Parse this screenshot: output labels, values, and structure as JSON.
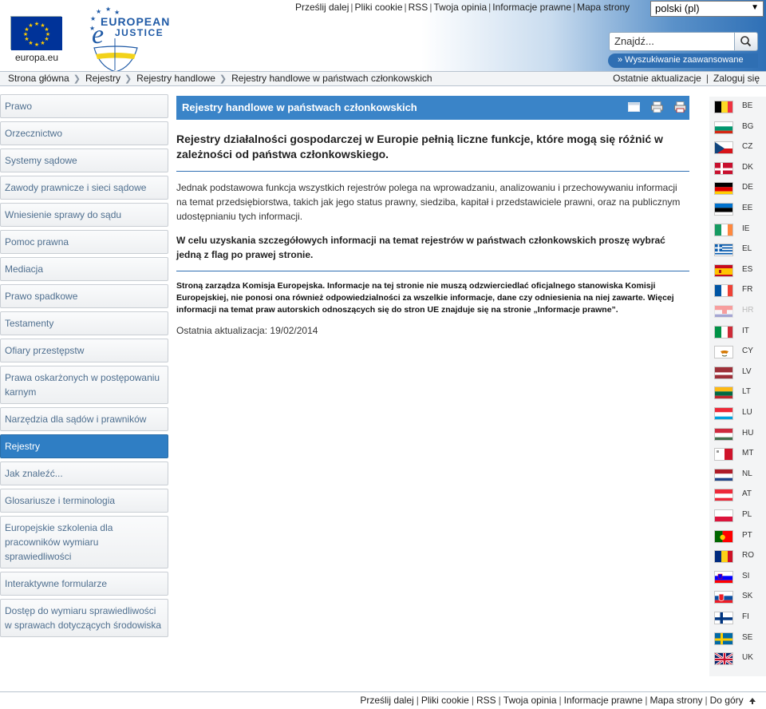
{
  "header": {
    "eu_logo_label": "europa.eu",
    "ej_logo_text": [
      "EUROPEAN",
      "JUSTICE"
    ],
    "top_links": [
      "Prześlij dalej",
      "Pliki cookie",
      "RSS",
      "Twoja opinia",
      "Informacje prawne",
      "Mapa strony"
    ],
    "language": "polski (pl)",
    "search_placeholder": "Znajdź...",
    "advanced_search": "» Wyszukiwanie zaawansowane"
  },
  "breadcrumb": [
    "Strona główna",
    "Rejestry",
    "Rejestry handlowe",
    "Rejestry handlowe w państwach członkowskich"
  ],
  "crumb_right": {
    "recent": "Ostatnie aktualizacje",
    "login": "Zaloguj się"
  },
  "nav": [
    {
      "label": "Prawo"
    },
    {
      "label": "Orzecznictwo"
    },
    {
      "label": "Systemy sądowe"
    },
    {
      "label": "Zawody prawnicze i sieci sądowe"
    },
    {
      "label": "Wniesienie sprawy do sądu"
    },
    {
      "label": "Pomoc prawna"
    },
    {
      "label": "Mediacja"
    },
    {
      "label": "Prawo spadkowe"
    },
    {
      "label": "Testamenty"
    },
    {
      "label": "Ofiary przestępstw"
    },
    {
      "label": "Prawa oskarżonych w postępowaniu karnym"
    },
    {
      "label": "Narzędzia dla sądów i prawników"
    },
    {
      "label": "Rejestry",
      "active": true
    },
    {
      "label": "Jak znaleźć..."
    },
    {
      "label": "Glosariusze i terminologia"
    },
    {
      "label": "Europejskie szkolenia dla pracowników wymiaru sprawiedliwości"
    },
    {
      "label": "Interaktywne formularze"
    },
    {
      "label": "Dostęp do wymiaru sprawiedliwości w sprawach dotyczących środowiska"
    }
  ],
  "main": {
    "title": "Rejestry handlowe w państwach członkowskich",
    "lead": "Rejestry działalności gospodarczej w Europie pełnią liczne funkcje, które mogą się różnić w zależności od państwa członkowskiego.",
    "body": "Jednak podstawowa funkcja wszystkich rejestrów polega na wprowadzaniu, analizowaniu i przechowywaniu informacji na temat przedsiębiorstwa, takich jak jego status prawny, siedziba, kapitał i przedstawiciele prawni, oraz na publicznym udostępnianiu tych informacji.",
    "instruction": "W celu uzyskania szczegółowych informacji na temat rejestrów w państwach członkowskich proszę wybrać jedną z flag po prawej stronie.",
    "disclaimer": "Stroną zarządza Komisja Europejska. Informacje na tej stronie nie muszą odzwierciedlać oficjalnego stanowiska Komisji Europejskiej, nie ponosi ona również odpowiedzialności za wszelkie informacje, dane czy odniesienia na niej zawarte. Więcej informacji na temat praw autorskich odnoszących się do stron UE znajduje się na stronie „Informacje prawne”.",
    "last_update": "Ostatnia aktualizacja: 19/02/2014"
  },
  "flags": [
    {
      "code": "BE"
    },
    {
      "code": "BG"
    },
    {
      "code": "CZ"
    },
    {
      "code": "DK"
    },
    {
      "code": "DE"
    },
    {
      "code": "EE"
    },
    {
      "code": "IE"
    },
    {
      "code": "EL"
    },
    {
      "code": "ES"
    },
    {
      "code": "FR"
    },
    {
      "code": "HR",
      "disabled": true
    },
    {
      "code": "IT"
    },
    {
      "code": "CY"
    },
    {
      "code": "LV"
    },
    {
      "code": "LT"
    },
    {
      "code": "LU"
    },
    {
      "code": "HU"
    },
    {
      "code": "MT"
    },
    {
      "code": "NL"
    },
    {
      "code": "AT"
    },
    {
      "code": "PL"
    },
    {
      "code": "PT"
    },
    {
      "code": "RO"
    },
    {
      "code": "SI"
    },
    {
      "code": "SK"
    },
    {
      "code": "FI"
    },
    {
      "code": "SE"
    },
    {
      "code": "UK"
    }
  ],
  "footer_links": [
    "Prześlij dalej",
    "Pliki cookie",
    "RSS",
    "Twoja opinia",
    "Informacje prawne",
    "Mapa strony",
    "Do góry"
  ],
  "colors": {
    "brand_blue": "#3a84c8",
    "active_nav": "#2f7ec4",
    "eu_blue": "#003399",
    "eu_gold": "#ffcc00"
  }
}
